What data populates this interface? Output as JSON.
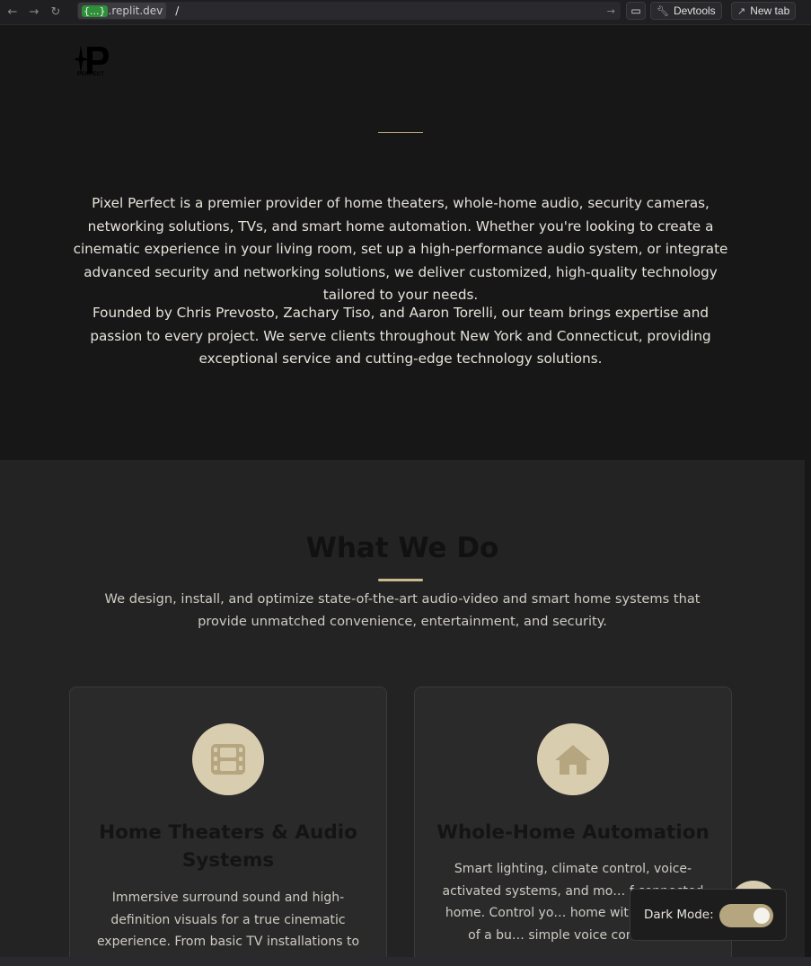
{
  "browser": {
    "back_icon": "arrow-left-icon",
    "forward_icon": "arrow-right-icon",
    "reload_icon": "reload-icon",
    "url_brace": "{...}",
    "url_host": ".replit.dev",
    "url_path": "/",
    "devtools_label": "Devtools",
    "newtab_label": "New tab"
  },
  "header": {
    "logo_text": "PERFECT"
  },
  "about": {
    "paragraph1": "Pixel Perfect is a premier provider of home theaters, whole-home audio, security cameras, networking solutions, TVs, and smart home automation. Whether you're looking to create a cinematic experience in your living room, set up a high-performance audio system, or integrate advanced security and networking solutions, we deliver customized, high-quality technology tailored to your needs.",
    "paragraph2": "Founded by Chris Prevosto, Zachary Tiso, and Aaron Torelli, our team brings expertise and passion to every project. We serve clients throughout New York and Connecticut, providing exceptional service and cutting-edge technology solutions."
  },
  "what_we_do": {
    "title": "What We Do",
    "subtitle": "We design, install, and optimize state-of-the-art audio-video and smart home systems that provide unmatched convenience, entertainment, and security.",
    "cards": [
      {
        "icon": "film-icon",
        "title": "Home Theaters & Audio Systems",
        "text": "Immersive surround sound and high-definition visuals for a true cinematic experience. From basic TV installations to"
      },
      {
        "icon": "home-icon",
        "title": "Whole-Home Automation",
        "text": "Smart lighting, climate control, voice-activated systems, and mo… f connected home. Control yo… home with the touch of a bu… simple voice command."
      }
    ]
  },
  "dark_mode": {
    "label": "Dark Mode:",
    "enabled": true
  },
  "colors": {
    "accent": "#c9b98d",
    "page_bg": "#171718",
    "section_bg": "#232324",
    "card_bg": "#2a2a2b"
  }
}
